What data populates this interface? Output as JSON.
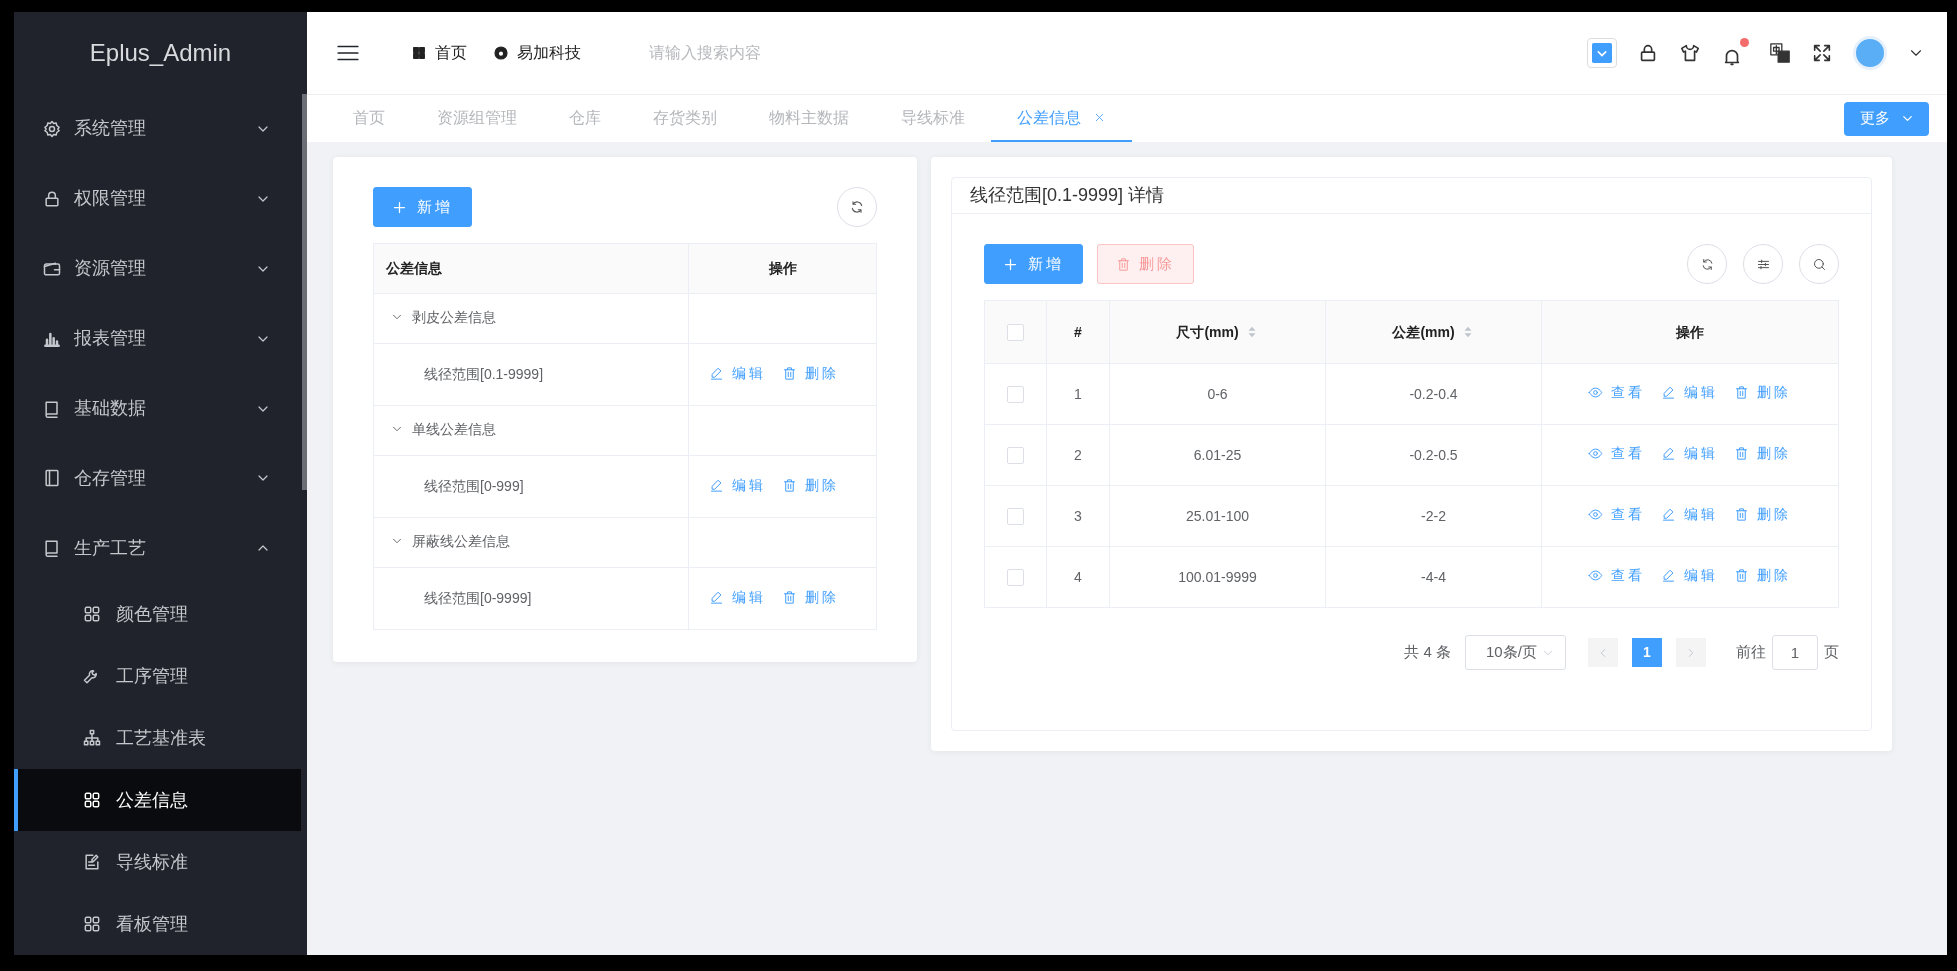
{
  "brand": "Eplus_Admin",
  "sidebar": {
    "items": [
      {
        "label": "系统管理",
        "expanded": false
      },
      {
        "label": "权限管理",
        "expanded": false
      },
      {
        "label": "资源管理",
        "expanded": false
      },
      {
        "label": "报表管理",
        "expanded": false
      },
      {
        "label": "基础数据",
        "expanded": false
      },
      {
        "label": "仓存管理",
        "expanded": false
      },
      {
        "label": "生产工艺",
        "expanded": true,
        "children": [
          {
            "label": "颜色管理",
            "selected": false
          },
          {
            "label": "工序管理",
            "selected": false
          },
          {
            "label": "工艺基准表",
            "selected": false
          },
          {
            "label": "公差信息",
            "selected": true
          },
          {
            "label": "导线标准",
            "selected": false
          },
          {
            "label": "看板管理",
            "selected": false
          }
        ]
      }
    ]
  },
  "header": {
    "links": [
      {
        "label": "首页"
      },
      {
        "label": "易加科技"
      }
    ],
    "search": {
      "placeholder": "请输入搜索内容"
    },
    "notifications": {
      "unread": true
    }
  },
  "tabs": [
    {
      "label": "首页",
      "selected": false,
      "closable": false
    },
    {
      "label": "资源组管理",
      "selected": false,
      "closable": false
    },
    {
      "label": "仓库",
      "selected": false,
      "closable": false
    },
    {
      "label": "存货类别",
      "selected": false,
      "closable": false
    },
    {
      "label": "物料主数据",
      "selected": false,
      "closable": false
    },
    {
      "label": "导线标准",
      "selected": false,
      "closable": false
    },
    {
      "label": "公差信息",
      "selected": true,
      "closable": true
    }
  ],
  "more_button": "更多",
  "left_panel": {
    "add_button": "新增",
    "columns": [
      "公差信息",
      "操作"
    ],
    "groups": [
      {
        "label": "剥皮公差信息",
        "expanded": true,
        "children": [
          {
            "label": "线径范围[0.1-9999]",
            "actions": [
              {
                "kind": "edit",
                "label": "编辑"
              },
              {
                "kind": "delete",
                "label": "删除"
              }
            ]
          }
        ]
      },
      {
        "label": "单线公差信息",
        "expanded": true,
        "children": [
          {
            "label": "线径范围[0-999]",
            "actions": [
              {
                "kind": "edit",
                "label": "编辑"
              },
              {
                "kind": "delete",
                "label": "删除"
              }
            ]
          }
        ]
      },
      {
        "label": "屏蔽线公差信息",
        "expanded": true,
        "children": [
          {
            "label": "线径范围[0-9999]",
            "actions": [
              {
                "kind": "edit",
                "label": "编辑"
              },
              {
                "kind": "delete",
                "label": "删除"
              }
            ]
          }
        ]
      }
    ]
  },
  "detail": {
    "title": "线径范围[0.1-9999] 详情",
    "add_button": "新增",
    "delete_button": {
      "label": "删除",
      "disabled": true
    },
    "select_all": {
      "checked": false
    },
    "columns": [
      {
        "label": "#",
        "sortable": false
      },
      {
        "label": "尺寸(mm)",
        "sortable": true
      },
      {
        "label": "公差(mm)",
        "sortable": true
      },
      {
        "label": "操作",
        "sortable": false
      }
    ],
    "rows": [
      {
        "checked": false,
        "cells": [
          "1",
          "0-6",
          "-0.2-0.4"
        ],
        "actions": [
          {
            "kind": "view",
            "label": "查看"
          },
          {
            "kind": "edit",
            "label": "编辑"
          },
          {
            "kind": "delete",
            "label": "删除"
          }
        ]
      },
      {
        "checked": false,
        "cells": [
          "2",
          "6.01-25",
          "-0.2-0.5"
        ],
        "actions": [
          {
            "kind": "view",
            "label": "查看"
          },
          {
            "kind": "edit",
            "label": "编辑"
          },
          {
            "kind": "delete",
            "label": "删除"
          }
        ]
      },
      {
        "checked": false,
        "cells": [
          "3",
          "25.01-100",
          "-2-2"
        ],
        "actions": [
          {
            "kind": "view",
            "label": "查看"
          },
          {
            "kind": "edit",
            "label": "编辑"
          },
          {
            "kind": "delete",
            "label": "删除"
          }
        ]
      },
      {
        "checked": false,
        "cells": [
          "4",
          "100.01-9999",
          "-4-4"
        ],
        "actions": [
          {
            "kind": "view",
            "label": "查看"
          },
          {
            "kind": "edit",
            "label": "编辑"
          },
          {
            "kind": "delete",
            "label": "删除"
          }
        ]
      }
    ],
    "pagination": {
      "total": "共 4 条",
      "page_size": "10条/页",
      "pages": [
        {
          "label": "1",
          "selected": true
        }
      ],
      "goto_label": "前往",
      "goto_value": "1",
      "goto_suffix": "页"
    }
  }
}
